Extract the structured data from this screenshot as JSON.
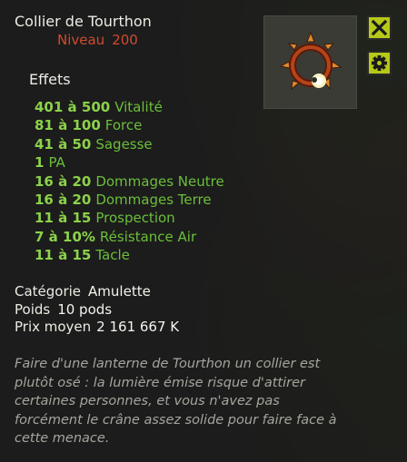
{
  "item": {
    "name": "Collier de Tourthon",
    "level_label": "Niveau",
    "level_value": "200"
  },
  "buttons": {
    "close_icon": "close-icon",
    "settings_icon": "gear-icon"
  },
  "effects": {
    "title": "Effets",
    "list": [
      {
        "range": "401 à 500",
        "stat": "Vitalité"
      },
      {
        "range": "81 à 100",
        "stat": "Force"
      },
      {
        "range": "41 à 50",
        "stat": "Sagesse"
      },
      {
        "range": "1",
        "stat": "PA"
      },
      {
        "range": "16 à 20",
        "stat": "Dommages Neutre"
      },
      {
        "range": "16 à 20",
        "stat": "Dommages Terre"
      },
      {
        "range": "11 à 15",
        "stat": "Prospection"
      },
      {
        "range": "7 à 10%",
        "stat": "Résistance Air"
      },
      {
        "range": "11 à 15",
        "stat": "Tacle"
      }
    ]
  },
  "info": {
    "category_label": "Catégorie",
    "category_value": "Amulette",
    "weight_label": "Poids",
    "weight_value": "10 pods",
    "price_label": "Prix moyen",
    "price_value": "2 161 667 K"
  },
  "description": "Faire d'une lanterne de Tourthon un collier est plutôt osé : la lumière émise risque d'attirer certaines personnes, et vous n'avez pas forcément le crâne assez solide pour faire face à cette menace.",
  "colors": {
    "accent_button": "#b6c818",
    "level_red": "#d24a2e",
    "effect_green": "#8cd24a"
  }
}
